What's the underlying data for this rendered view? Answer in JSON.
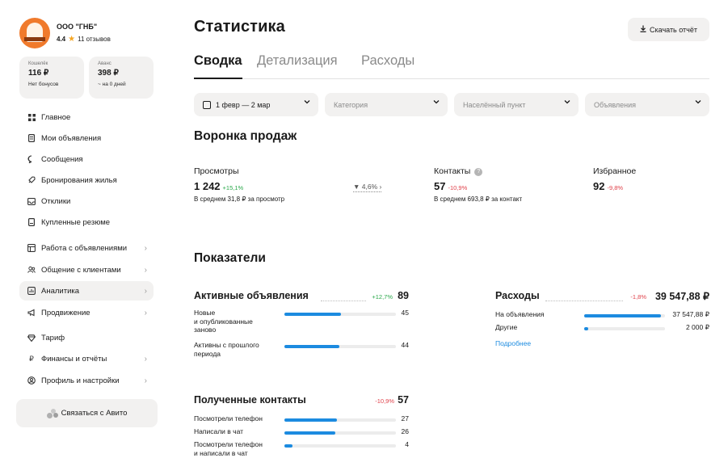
{
  "profile": {
    "company": "ООО \"ГНБ\"",
    "rating": "4.4",
    "reviews": "11 отзывов"
  },
  "wallets": [
    {
      "label": "Кошелёк",
      "value": "116 ₽",
      "sub": "Нет бонусов"
    },
    {
      "label": "Аванс",
      "value": "398 ₽",
      "sub": "~ на 0 дней"
    }
  ],
  "nav": [
    {
      "label": "Главное",
      "icon": "grid-icon",
      "chevron": false,
      "active": false
    },
    {
      "label": "Мои объявления",
      "icon": "document-icon",
      "chevron": false,
      "active": false
    },
    {
      "label": "Сообщения",
      "icon": "chat-bubble-icon",
      "chevron": false,
      "active": false
    },
    {
      "label": "Бронирования жилья",
      "icon": "rocket-icon",
      "chevron": false,
      "active": false
    },
    {
      "label": "Отклики",
      "icon": "inbox-icon",
      "chevron": false,
      "active": false
    },
    {
      "label": "Купленные резюме",
      "icon": "resume-icon",
      "chevron": false,
      "active": false
    },
    {
      "label": "Работа с объявлениями",
      "icon": "listing-tools-icon",
      "chevron": true,
      "active": false
    },
    {
      "label": "Общение с клиентами",
      "icon": "people-icon",
      "chevron": true,
      "active": false
    },
    {
      "label": "Аналитика",
      "icon": "bar-chart-icon",
      "chevron": true,
      "active": true
    },
    {
      "label": "Продвижение",
      "icon": "megaphone-icon",
      "chevron": true,
      "active": false
    },
    {
      "label": "Тариф",
      "icon": "diamond-icon",
      "chevron": false,
      "active": false
    },
    {
      "label": "Финансы и отчёты",
      "icon": "ruble-icon",
      "chevron": true,
      "active": false
    },
    {
      "label": "Профиль и настройки",
      "icon": "user-circle-icon",
      "chevron": true,
      "active": false
    }
  ],
  "contact_button": "Связаться с Авито",
  "page": {
    "title": "Статистика",
    "download": "Скачать отчёт",
    "tabs": [
      "Сводка",
      "Детализация",
      "Расходы"
    ],
    "filters": [
      "1 февр — 2 мар",
      "Категория",
      "Населённый пункт",
      "Объявления"
    ]
  },
  "funnel": {
    "title": "Воронка продаж",
    "conversion": "4,6%",
    "kpis": [
      {
        "name": "Просмотры",
        "value": "1 242",
        "delta": "+15,1%",
        "avg": "В среднем 31,8 ₽ за просмотр"
      },
      {
        "name": "Контакты",
        "value": "57",
        "delta": "-10,9%",
        "avg": "В среднем 693,8 ₽ за контакт"
      },
      {
        "name": "Избранное",
        "value": "92",
        "delta": "-9,8%",
        "avg": ""
      }
    ]
  },
  "indicators": {
    "title": "Показатели",
    "active": {
      "title": "Активные объявления",
      "delta": "+12,7%",
      "total": "89",
      "rows": [
        {
          "label": "Новые\nи опубликованные\nзаново",
          "value": "45",
          "share": 0.51
        },
        {
          "label": "Активны с прошлого\nпериода",
          "value": "44",
          "share": 0.49
        }
      ]
    },
    "expenses": {
      "title": "Расходы",
      "delta": "-1,8%",
      "total": "39 547,88 ₽",
      "rows": [
        {
          "label": "На объявления",
          "value": "37 547,88 ₽",
          "share": 0.95
        },
        {
          "label": "Другие",
          "value": "2 000 ₽",
          "share": 0.05
        }
      ],
      "link": "Подробнее"
    },
    "contacts": {
      "title": "Полученные контакты",
      "delta": "-10,9%",
      "total": "57",
      "rows": [
        {
          "label": "Посмотрели телефон",
          "value": "27",
          "share": 0.47
        },
        {
          "label": "Написали в чат",
          "value": "26",
          "share": 0.46
        },
        {
          "label": "Посмотрели телефон\nи написали в чат",
          "value": "4",
          "share": 0.07
        }
      ]
    }
  },
  "colors": {
    "accent": "#1c8be0",
    "positive": "#2aa84a",
    "negative": "#e0424b",
    "surface": "#f2f1f0",
    "avatar": "#f07a2c"
  }
}
